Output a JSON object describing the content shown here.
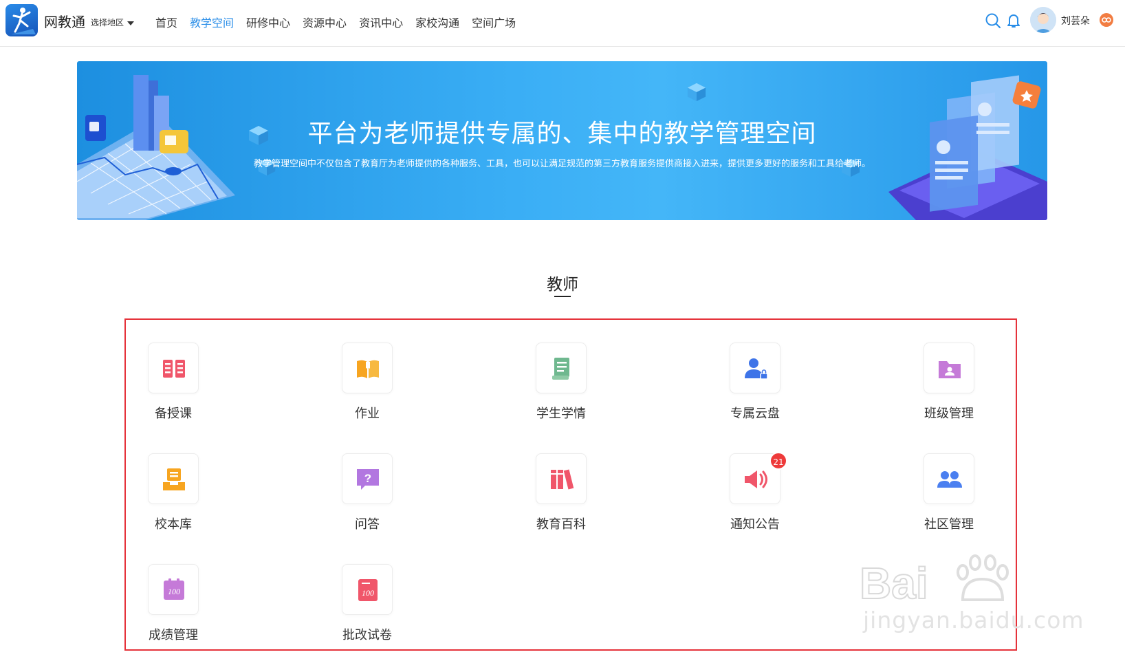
{
  "header": {
    "brand": "网教通",
    "region_label": "选择地区",
    "nav": [
      {
        "label": "首页",
        "active": false
      },
      {
        "label": "教学空间",
        "active": true
      },
      {
        "label": "研修中心",
        "active": false
      },
      {
        "label": "资源中心",
        "active": false
      },
      {
        "label": "资讯中心",
        "active": false
      },
      {
        "label": "家校沟通",
        "active": false
      },
      {
        "label": "空间广场",
        "active": false
      }
    ],
    "username": "刘芸朵",
    "accent_color": "#2a8ee8"
  },
  "banner": {
    "title": "平台为老师提供专属的、集中的教学管理空间",
    "subtitle": "教学管理空间中不仅包含了教育厅为老师提供的各种服务、工具，也可以让满足规范的第三方教育服务提供商接入进来，提供更多更好的服务和工具给老师。"
  },
  "section": {
    "title": "教师"
  },
  "apps": [
    {
      "label": "备授课",
      "icon": "book-open-icon",
      "color": "#f0566a"
    },
    {
      "label": "作业",
      "icon": "open-book-icon",
      "color": "#f7a520"
    },
    {
      "label": "学生学情",
      "icon": "document-icon",
      "color": "#6fb88f"
    },
    {
      "label": "专属云盘",
      "icon": "user-lock-icon",
      "color": "#3e74e8"
    },
    {
      "label": "班级管理",
      "icon": "folder-user-icon",
      "color": "#c57ad8"
    },
    {
      "label": "校本库",
      "icon": "archive-icon",
      "color": "#f7a520"
    },
    {
      "label": "问答",
      "icon": "question-icon",
      "color": "#b277e0"
    },
    {
      "label": "教育百科",
      "icon": "books-icon",
      "color": "#f0566a"
    },
    {
      "label": "通知公告",
      "icon": "speaker-icon",
      "color": "#f0566a",
      "badge": "21"
    },
    {
      "label": "社区管理",
      "icon": "group-icon",
      "color": "#4a7ff0"
    },
    {
      "label": "成绩管理",
      "icon": "score-icon",
      "color": "#c57ad8"
    },
    {
      "label": "批改试卷",
      "icon": "exam-paper-icon",
      "color": "#f0566a"
    }
  ],
  "watermark": {
    "text": "jingyan.baidu.com"
  }
}
